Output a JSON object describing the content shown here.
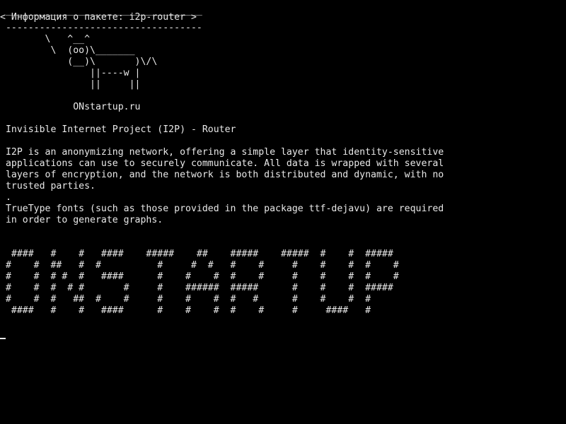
{
  "colors": {
    "background": "#000000",
    "foreground": "#e8e8e8"
  },
  "cowsay": {
    "bubble_top": " ___________________________________",
    "bubble_text": "< Информация о пакете: i2p-router >",
    "bubble_bottom": " -----------------------------------",
    "cow": [
      "        \\   ^__^",
      "         \\  (oo)\\_______",
      "            (__)\\       )\\/\\",
      "                ||----w |",
      "                ||     ||"
    ]
  },
  "site": "             ONstartup.ru",
  "package": {
    "title": " Invisible Internet Project (I2P) - Router",
    "description": [
      " I2P is an anonymizing network, offering a simple layer that identity-sensitive",
      " applications can use to securely communicate. All data is wrapped with several",
      " layers of encryption, and the network is both distributed and dynamic, with no",
      " trusted parties.",
      " .",
      " TrueType fonts (such as those provided in the package ttf-dejavu) are required",
      " in order to generate graphs."
    ]
  },
  "banner": [
    "  ####   #    #   ####    #####    ##    #####    #####  #    #  #####",
    " #    #  ##   #  #          #     #  #   #    #     #    #    #  #    #",
    " #    #  # #  #   ####      #    #    #  #    #     #    #    #  #    #",
    " #    #  #  # #       #     #    ######  #####      #    #    #  #####",
    " #    #  #   ##  #    #     #    #    #  #   #      #    #    #  #",
    "  ####   #    #   ####      #    #    #  #    #     #     ####   #"
  ]
}
